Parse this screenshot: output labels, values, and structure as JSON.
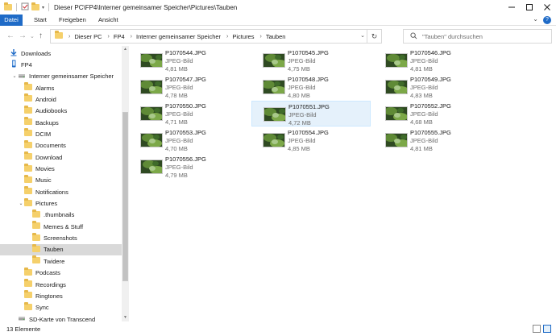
{
  "window": {
    "title": "Dieser PC\\FP4\\Interner gemeinsamer Speicher\\Pictures\\Tauben",
    "controls": [
      "minimize",
      "maximize",
      "close"
    ]
  },
  "ribbon": {
    "tabs": [
      "Datei",
      "Start",
      "Freigeben",
      "Ansicht"
    ],
    "help": "?"
  },
  "address": {
    "breadcrumbs": [
      "Dieser PC",
      "FP4",
      "Interner gemeinsamer Speicher",
      "Pictures",
      "Tauben"
    ]
  },
  "search": {
    "placeholder": "\"Tauben\" durchsuchen"
  },
  "navpane": {
    "items": [
      {
        "label": "Downloads",
        "indent": 0,
        "icon": "download-arrow-icon"
      },
      {
        "label": "FP4",
        "indent": 0,
        "icon": "phone-icon"
      },
      {
        "label": "Interner gemeinsamer Speicher",
        "indent": 1,
        "icon": "drive-icon",
        "expanded": true
      },
      {
        "label": "Alarms",
        "indent": 2,
        "icon": "folder-icon"
      },
      {
        "label": "Android",
        "indent": 2,
        "icon": "folder-icon"
      },
      {
        "label": "Audiobooks",
        "indent": 2,
        "icon": "folder-icon"
      },
      {
        "label": "Backups",
        "indent": 2,
        "icon": "folder-icon"
      },
      {
        "label": "DCIM",
        "indent": 2,
        "icon": "folder-icon"
      },
      {
        "label": "Documents",
        "indent": 2,
        "icon": "folder-icon"
      },
      {
        "label": "Download",
        "indent": 2,
        "icon": "folder-icon"
      },
      {
        "label": "Movies",
        "indent": 2,
        "icon": "folder-icon"
      },
      {
        "label": "Music",
        "indent": 2,
        "icon": "folder-icon"
      },
      {
        "label": "Notifications",
        "indent": 2,
        "icon": "folder-icon"
      },
      {
        "label": "Pictures",
        "indent": 2,
        "icon": "folder-icon",
        "expanded": true
      },
      {
        "label": ".thumbnails",
        "indent": 3,
        "icon": "folder-icon"
      },
      {
        "label": "Memes & Stuff",
        "indent": 3,
        "icon": "folder-icon"
      },
      {
        "label": "Screenshots",
        "indent": 3,
        "icon": "folder-icon"
      },
      {
        "label": "Tauben",
        "indent": 3,
        "icon": "folder-icon",
        "selected": true
      },
      {
        "label": "Twidere",
        "indent": 3,
        "icon": "folder-icon"
      },
      {
        "label": "Podcasts",
        "indent": 2,
        "icon": "folder-icon"
      },
      {
        "label": "Recordings",
        "indent": 2,
        "icon": "folder-icon"
      },
      {
        "label": "Ringtones",
        "indent": 2,
        "icon": "folder-icon"
      },
      {
        "label": "Sync",
        "indent": 2,
        "icon": "folder-icon"
      },
      {
        "label": "SD-Karte von Transcend",
        "indent": 1,
        "icon": "drive-icon"
      }
    ]
  },
  "files": [
    {
      "name": "P1070544.JPG",
      "type": "JPEG-Bild",
      "size": "4,81 MB"
    },
    {
      "name": "P1070545.JPG",
      "type": "JPEG-Bild",
      "size": "4,75 MB"
    },
    {
      "name": "P1070546.JPG",
      "type": "JPEG-Bild",
      "size": "4,81 MB"
    },
    {
      "name": "P1070547.JPG",
      "type": "JPEG-Bild",
      "size": "4,78 MB"
    },
    {
      "name": "P1070548.JPG",
      "type": "JPEG-Bild",
      "size": "4,80 MB"
    },
    {
      "name": "P1070549.JPG",
      "type": "JPEG-Bild",
      "size": "4,83 MB"
    },
    {
      "name": "P1070550.JPG",
      "type": "JPEG-Bild",
      "size": "4,71 MB"
    },
    {
      "name": "P1070551.JPG",
      "type": "JPEG-Bild",
      "size": "4,72 MB",
      "selected": true
    },
    {
      "name": "P1070552.JPG",
      "type": "JPEG-Bild",
      "size": "4,68 MB"
    },
    {
      "name": "P1070553.JPG",
      "type": "JPEG-Bild",
      "size": "4,70 MB"
    },
    {
      "name": "P1070554.JPG",
      "type": "JPEG-Bild",
      "size": "4,85 MB"
    },
    {
      "name": "P1070555.JPG",
      "type": "JPEG-Bild",
      "size": "4,81 MB"
    },
    {
      "name": "P1070556.JPG",
      "type": "JPEG-Bild",
      "size": "4,79 MB"
    }
  ],
  "status": {
    "count": "13 Elemente"
  },
  "colors": {
    "accent": "#1f6bc7",
    "selection": "#e5f1fb",
    "nav_selected": "#d9d9d9",
    "folder": "#f5d06b"
  }
}
